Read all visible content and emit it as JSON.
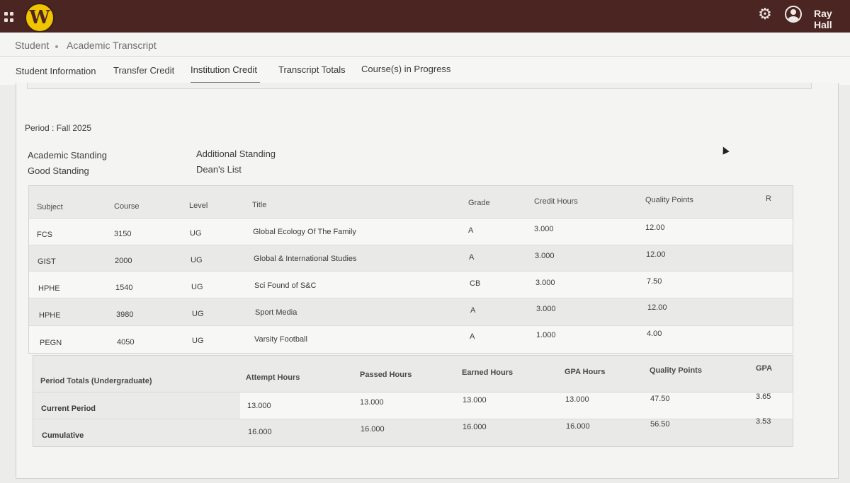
{
  "header": {
    "logo_letter": "W",
    "user_name": "Ray Hall",
    "icons": [
      "apps-grid-icon",
      "gear-icon",
      "user-avatar-icon"
    ]
  },
  "breadcrumb": {
    "root": "Student",
    "current": "Academic Transcript"
  },
  "tabs": [
    {
      "label": "Student Information"
    },
    {
      "label": "Transfer Credit"
    },
    {
      "label": "Institution Credit",
      "active": true
    },
    {
      "label": "Transcript Totals"
    },
    {
      "label": "Course(s) in Progress"
    }
  ],
  "period": {
    "label": "Period : Fall 2025"
  },
  "standing": {
    "academic_label": "Academic Standing",
    "academic_value": "Good Standing",
    "additional_label": "Additional Standing",
    "additional_value": "Dean's List"
  },
  "courses": {
    "headers": [
      "Subject",
      "Course",
      "Level",
      "Title",
      "Grade",
      "Credit Hours",
      "Quality Points",
      "R"
    ],
    "rows": [
      [
        "FCS",
        "3150",
        "UG",
        "Global Ecology Of The Family",
        "A",
        "3.000",
        "12.00",
        ""
      ],
      [
        "GIST",
        "2000",
        "UG",
        "Global & International Studies",
        "A",
        "3.000",
        "12.00",
        ""
      ],
      [
        "HPHE",
        "1540",
        "UG",
        "Sci Found of S&C",
        "CB",
        "3.000",
        "7.50",
        ""
      ],
      [
        "HPHE",
        "3980",
        "UG",
        "Sport Media",
        "A",
        "3.000",
        "12.00",
        ""
      ],
      [
        "PEGN",
        "4050",
        "UG",
        "Varsity Football",
        "A",
        "1.000",
        "4.00",
        ""
      ]
    ]
  },
  "totals": {
    "headers": [
      "Period Totals (Undergraduate)",
      "Attempt Hours",
      "Passed Hours",
      "Earned Hours",
      "GPA Hours",
      "Quality Points",
      "GPA"
    ],
    "rows": [
      [
        "Current Period",
        "13.000",
        "13.000",
        "13.000",
        "13.000",
        "47.50",
        "3.65"
      ],
      [
        "Cumulative",
        "16.000",
        "16.000",
        "16.000",
        "16.000",
        "56.50",
        "3.53"
      ]
    ]
  }
}
